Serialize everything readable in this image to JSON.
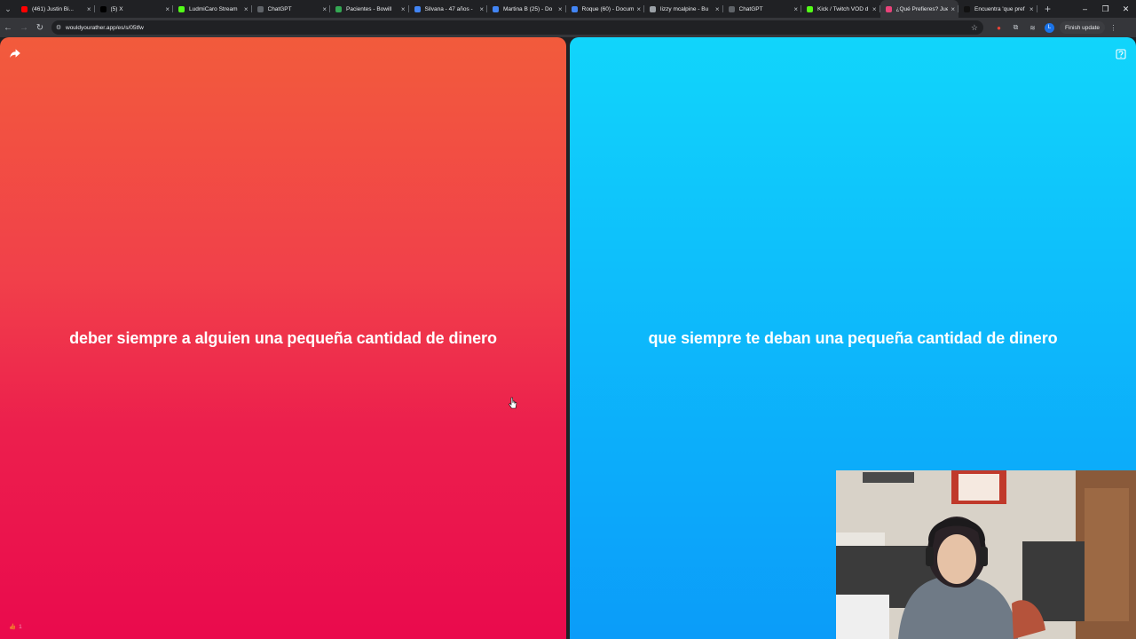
{
  "browser": {
    "tabs": [
      {
        "title": "(461) Justin Bi...",
        "favicon_color": "#ff0000",
        "active": false
      },
      {
        "title": "(5) X",
        "favicon_color": "#000000",
        "active": false
      },
      {
        "title": "LudmiCaro Stream",
        "favicon_color": "#53fc18",
        "active": false
      },
      {
        "title": "ChatGPT",
        "favicon_color": "#5f6368",
        "active": false
      },
      {
        "title": "Pacientes - Bowill",
        "favicon_color": "#34a853",
        "active": false
      },
      {
        "title": "Silvana - 47 años -",
        "favicon_color": "#4285f4",
        "active": false
      },
      {
        "title": "Martina B (25) - Do",
        "favicon_color": "#4285f4",
        "active": false
      },
      {
        "title": "Roque (60) - Docum",
        "favicon_color": "#4285f4",
        "active": false
      },
      {
        "title": "lizzy mcalpine - Bu",
        "favicon_color": "#9aa0a6",
        "active": false
      },
      {
        "title": "ChatGPT",
        "favicon_color": "#5f6368",
        "active": false
      },
      {
        "title": "Kick / Twitch VOD d",
        "favicon_color": "#53fc18",
        "active": false
      },
      {
        "title": "¿Qué Prefieres? Jue",
        "favicon_color": "#e8437a",
        "active": true
      },
      {
        "title": "Encuentra 'que pref",
        "favicon_color": "#111111",
        "active": false
      }
    ],
    "url": "wouldyourather.app/es/s/05tfw",
    "finish_update_label": "Finish update",
    "profile_initial": "L"
  },
  "game": {
    "option_left": "deber siempre a alguien una pequeña cantidad de dinero",
    "option_right": "que siempre te deban una pequeña cantidad de dinero",
    "likes_count": "1",
    "colors": {
      "left_top": "#f25b3c",
      "left_bottom": "#ea0a4d",
      "right_top": "#11d5fb",
      "right_bottom": "#0b9cf9"
    }
  },
  "icons": {
    "share": "share-icon",
    "help": "help-icon",
    "like": "thumbs-up-icon"
  }
}
